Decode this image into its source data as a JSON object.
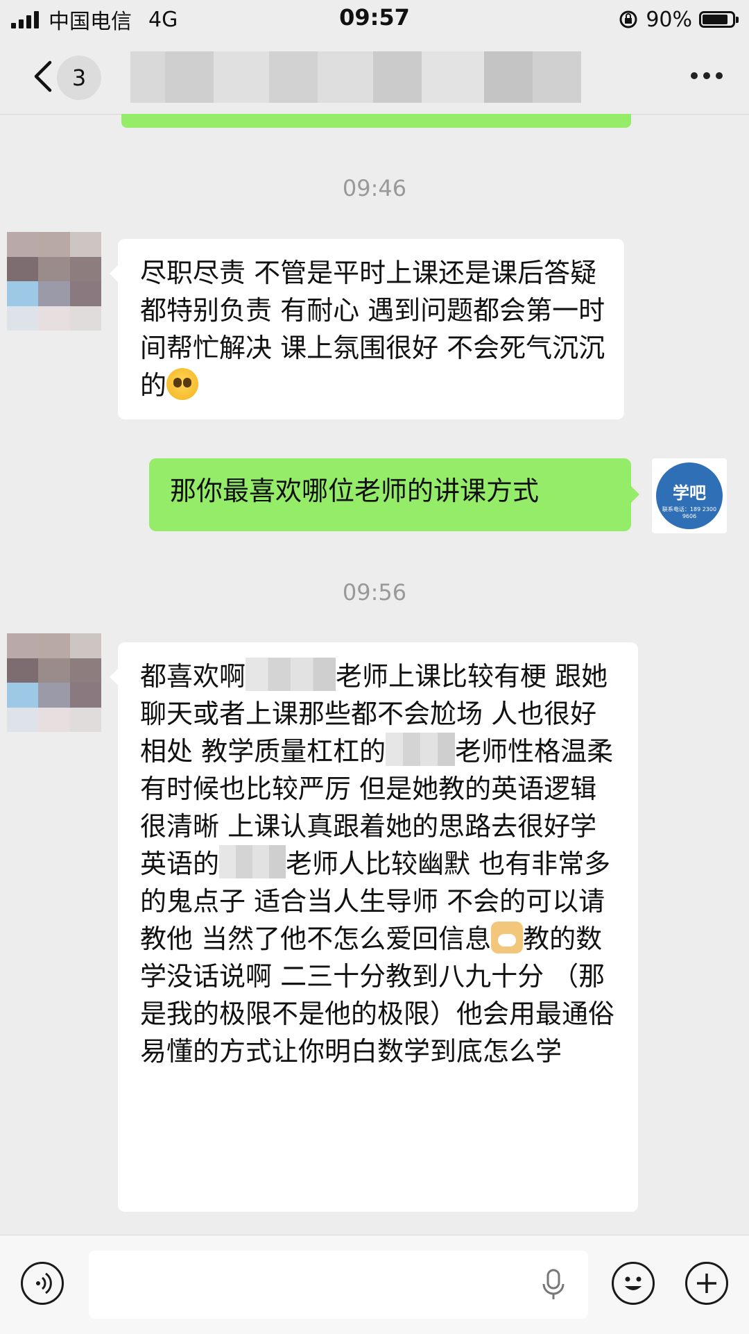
{
  "status_bar": {
    "carrier": "中国电信",
    "network": "4G",
    "time": "09:57",
    "battery": "90%",
    "battery_level": 0.9
  },
  "nav": {
    "unread_count": "3"
  },
  "messages": [
    {
      "type": "time",
      "text": "09:46"
    },
    {
      "type": "incoming",
      "text": "尽职尽责 不管是平时上课还是课后答疑 都特别负责 有耐心 遇到问题都会第一时间帮忙解决 课上氛围很好 不会死气沉沉的",
      "emoji": "pleading-face-icon"
    },
    {
      "type": "outgoing",
      "text": "那你最喜欢哪位老师的讲课方式"
    },
    {
      "type": "time",
      "text": "09:56"
    },
    {
      "type": "incoming",
      "parts": {
        "p1": "都喜欢啊",
        "p2": "老师上课比较有梗 跟她聊天或者上课那些都不会尬场 人也很好相处 教学质量杠杠的",
        "p3": "老师性格温柔有时候也比较严厉 但是她教的英语逻辑很清晰 上课认真跟着她的思路去很好学英语的",
        "p4": "老师人比较幽默 也有非常多的鬼点子 适合当人生导师 不会的可以请教他 当然了他不怎么爱回信息",
        "p5": "教的数学没话说啊 二三十分教到八九十分 （那是我的极限不是他的极限）他会用最通俗易懂的方式让你明白数学到底怎么学"
      }
    }
  ],
  "self_avatar": {
    "logo_text": "学吧",
    "logo_subtext": "联系电话：189 2300 9606"
  },
  "colors": {
    "background": "#ededed",
    "outgoing_bubble": "#95ec69",
    "incoming_bubble": "#ffffff",
    "time_label": "#999999"
  }
}
